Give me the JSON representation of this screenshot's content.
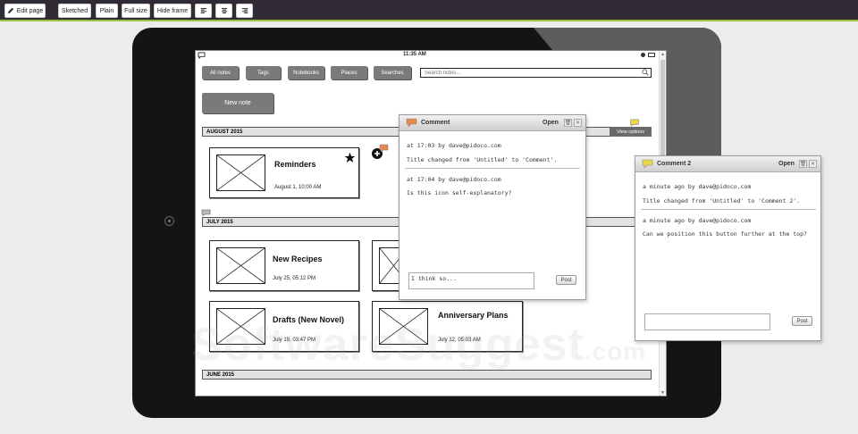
{
  "toolbar": {
    "edit_page": "Edit page",
    "sketched": "Sketched",
    "plain": "Plain",
    "full_size": "Full size",
    "hide_frame": "Hide frame",
    "align_icons": [
      "align-left-icon",
      "align-center-icon",
      "align-right-icon"
    ]
  },
  "status": {
    "time": "11:35 AM"
  },
  "nav": {
    "all_notes": "All notes",
    "tags": "Tags",
    "notebooks": "Notebooks",
    "places": "Places",
    "searches": "Searches",
    "search_placeholder": "Search notes..."
  },
  "new_note": "New note",
  "view_options": "View options",
  "sections": {
    "aug": "AUGUST 2015",
    "jul": "JULY 2015",
    "jun": "JUNE 2015"
  },
  "cards": {
    "reminders": {
      "title": "Reminders",
      "date": "August 1, 10:00 AM"
    },
    "recipes": {
      "title": "New Recipes",
      "date": "July 25, 05:12 PM"
    },
    "drafts": {
      "title": "Drafts (New Novel)",
      "date": "July 19, 03:47 PM"
    },
    "anniversary": {
      "title": "Anniversary Plans",
      "date": "July 12, 05:03 AM"
    }
  },
  "comment1": {
    "title": "Comment",
    "open": "Open",
    "entries": [
      {
        "meta": "at 17:03 by dave@pidoco.com",
        "text": "Title changed from 'Untitled' to 'Comment'."
      },
      {
        "meta": "at 17:04 by dave@pidoco.com",
        "text": "Is this icon self-explanatory?"
      }
    ],
    "reply": "I think so...",
    "post": "Post"
  },
  "comment2": {
    "title": "Comment 2",
    "open": "Open",
    "entries": [
      {
        "meta": "a minute ago by dave@pidoco.com",
        "text": "Title changed from 'Untitled' to 'Comment 2'."
      },
      {
        "meta": "a minute ago by dave@pidoco.com",
        "text": "Can we position this button further at the top?"
      }
    ],
    "reply": "",
    "post": "Post"
  },
  "watermark": {
    "main": "SoftwareSuggest",
    "suffix": ".com"
  },
  "colors": {
    "accent_line": "#9ac23c",
    "comment_bubble_orange": "#e8874e",
    "comment_bubble_yellow": "#e8d84a"
  }
}
